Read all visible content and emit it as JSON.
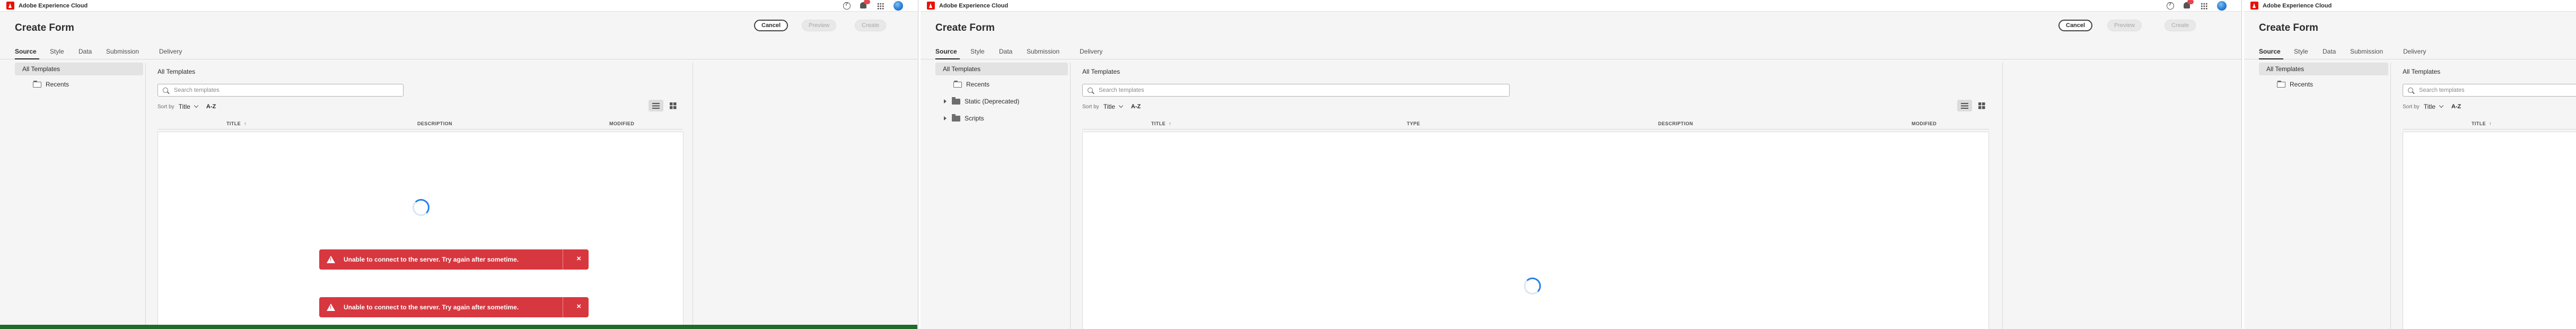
{
  "app": {
    "brand": "Adobe Experience Cloud"
  },
  "header": {
    "title": "Create Form",
    "cancel": "Cancel",
    "preview": "Preview",
    "create": "Create"
  },
  "tabs": [
    "Source",
    "Style",
    "Data",
    "Submission",
    "Delivery"
  ],
  "nav": {
    "all": "All Templates",
    "recents": "Recents",
    "static": "Static (Deprecated)",
    "scripts": "Scripts"
  },
  "main": {
    "breadcrumb": "All Templates",
    "search_placeholder": "Search templates",
    "sort_label": "Sort by",
    "sort_value": "Title",
    "sort_order": "A-Z"
  },
  "columns": {
    "title": "TITLE",
    "type": "TYPE",
    "description": "DESCRIPTION",
    "modified": "MODIFIED"
  },
  "toast": {
    "message": "Unable to connect to the server. Try again after sometime.",
    "close": "×"
  },
  "colors": {
    "accent": "#2680eb",
    "error": "#d7373f",
    "brand": "#eb1000"
  }
}
